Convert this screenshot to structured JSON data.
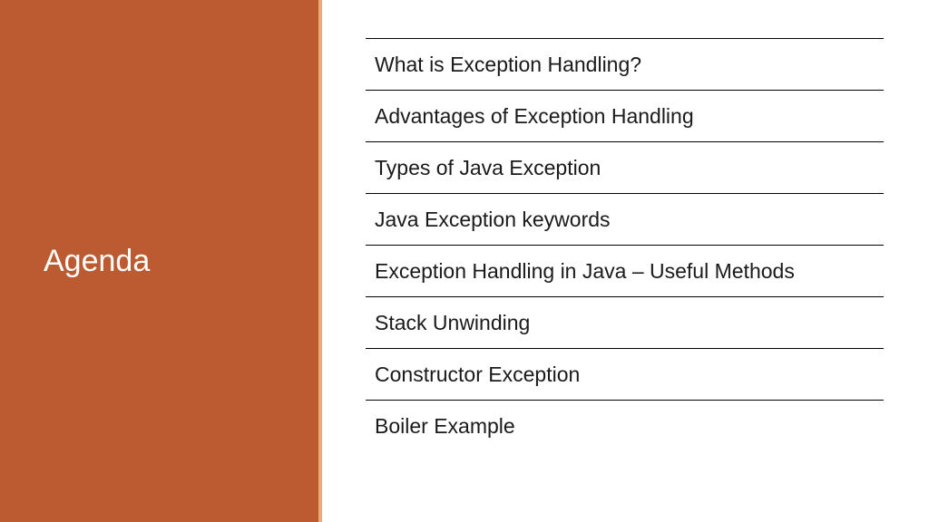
{
  "sidebar": {
    "title": "Agenda"
  },
  "agenda": {
    "items": [
      {
        "label": "What is Exception Handling?",
        "border": "border-orange"
      },
      {
        "label": "Advantages of Exception Handling",
        "border": "border-ochre"
      },
      {
        "label": "Types of Java Exception",
        "border": "border-olive"
      },
      {
        "label": "Java Exception keywords",
        "border": "border-olive"
      },
      {
        "label": "Exception Handling in Java – Useful Methods",
        "border": "border-orange"
      },
      {
        "label": "Stack Unwinding",
        "border": "border-orange"
      },
      {
        "label": "Constructor Exception",
        "border": "border-ochre"
      },
      {
        "label": "Boiler Example",
        "border": "border-orange"
      }
    ]
  }
}
